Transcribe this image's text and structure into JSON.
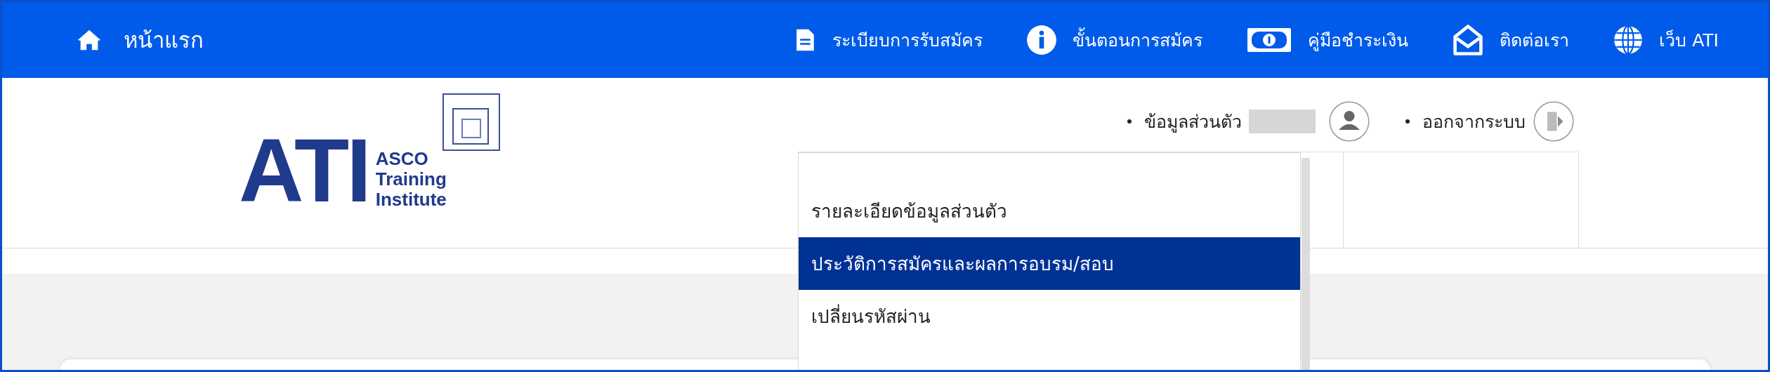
{
  "nav": {
    "home": {
      "label": "หน้าแรก"
    },
    "items": [
      {
        "label": "ระเบียบการรับสมัคร"
      },
      {
        "label": "ขั้นตอนการสมัคร"
      },
      {
        "label": "คู่มือชำระเงิน"
      },
      {
        "label": "ติดต่อเรา"
      },
      {
        "label": "เว็บ ATI"
      }
    ]
  },
  "logo": {
    "mark": "ATI",
    "lines": [
      "ASCO",
      "Training",
      "Institute"
    ]
  },
  "user_links": [
    {
      "label": "ข้อมูลส่วนตัว",
      "redacted": true
    },
    {
      "label": "ออกจากระบบ",
      "redacted": false
    }
  ],
  "dropdown": {
    "items": [
      {
        "label": "รายละเอียดข้อมูลส่วนตัว",
        "selected": false
      },
      {
        "label": "ประวัติการสมัครและผลการอบรม/สอบ",
        "selected": true
      },
      {
        "label": "เปลี่ยนรหัสผ่าน",
        "selected": false
      }
    ]
  }
}
